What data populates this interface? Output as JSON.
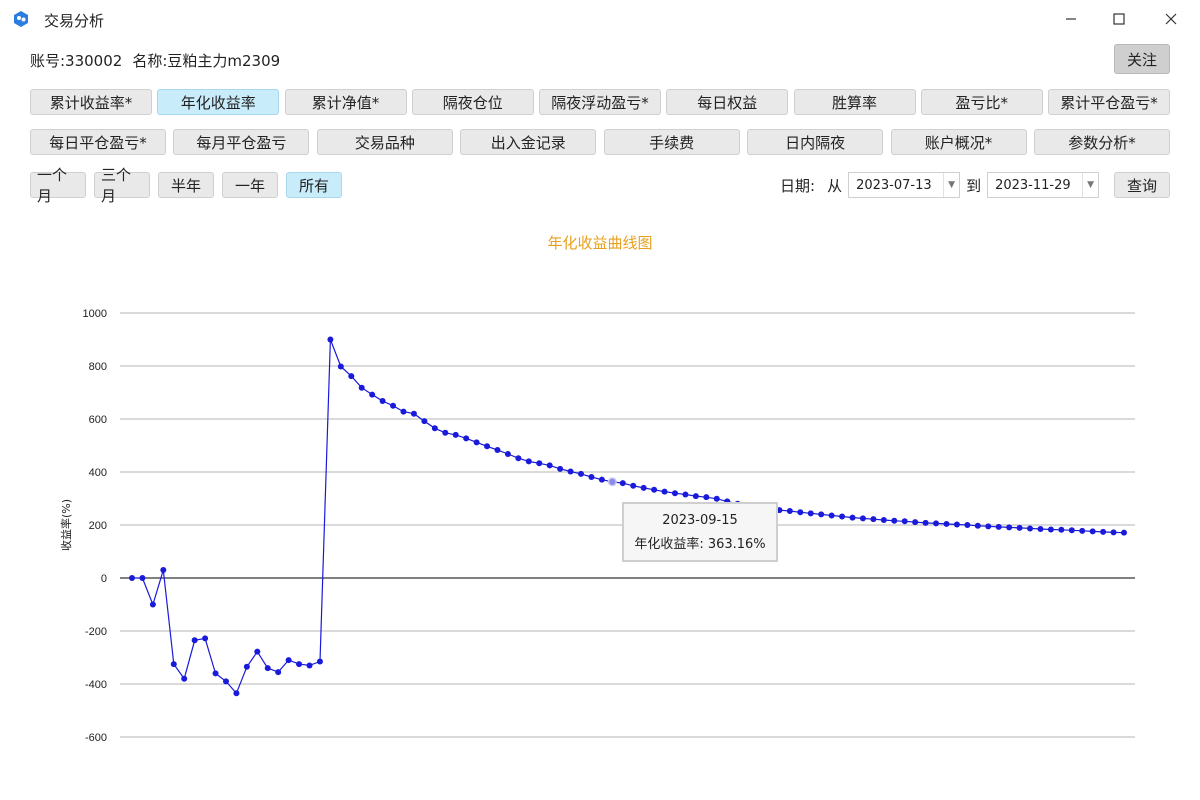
{
  "window": {
    "title": "交易分析",
    "icon": "app-logo-icon",
    "controls": [
      "minimize-icon",
      "maximize-icon",
      "close-icon"
    ]
  },
  "account": {
    "label": "账号:330002",
    "name_label": "名称:豆粕主力m2309"
  },
  "follow_label": "关注",
  "tabs_row1": [
    "累计收益率*",
    "年化收益率",
    "累计净值*",
    "隔夜仓位",
    "隔夜浮动盈亏*",
    "每日权益",
    "胜算率",
    "盈亏比*",
    "累计平仓盈亏*"
  ],
  "tabs_row2": [
    "每日平仓盈亏*",
    "每月平仓盈亏",
    "交易品种",
    "出入金记录",
    "手续费",
    "日内隔夜",
    "账户概况*",
    "参数分析*"
  ],
  "active_tab": "年化收益率",
  "ranges": [
    "一个月",
    "三个月",
    "半年",
    "一年",
    "所有"
  ],
  "active_range": "所有",
  "date_filter": {
    "label": "日期:",
    "from_label": "从",
    "from": "2023-07-13",
    "to_label": "到",
    "to": "2023-11-29",
    "query_label": "查询"
  },
  "chart_data": {
    "type": "line",
    "title": "年化收益曲线图",
    "ylabel": "收益率(%)",
    "xlabel": "",
    "ylim": [
      -600,
      1000
    ],
    "yticks": [
      1000,
      800,
      600,
      400,
      200,
      0,
      -200,
      -400,
      -600
    ],
    "grid": true,
    "color": "#1a1adb",
    "series": [
      {
        "values": [
          0,
          0,
          -100,
          30,
          -325,
          -380,
          -235,
          -228,
          -360,
          -390,
          -435,
          -335,
          -278,
          -340,
          -355,
          -310,
          -325,
          -330,
          -315,
          900,
          798,
          762,
          718,
          692,
          668,
          650,
          628,
          620,
          592,
          565,
          548,
          540,
          527,
          512,
          497,
          483,
          468,
          452,
          440,
          433,
          425,
          412,
          402,
          393,
          381,
          371,
          363,
          358,
          348,
          340,
          333,
          326,
          320,
          315,
          309,
          305,
          299,
          289,
          280,
          270,
          263,
          258,
          256,
          253,
          248,
          244,
          240,
          236,
          232,
          228,
          225,
          222,
          219,
          216,
          214,
          211,
          208,
          206,
          204,
          202,
          200,
          197,
          195,
          193,
          191,
          189,
          187,
          185,
          183,
          182,
          180,
          178,
          176,
          174,
          172,
          171
        ]
      }
    ],
    "tooltip": {
      "date": "2023-09-15",
      "label": "年化收益率: 363.16%",
      "index": 46
    }
  }
}
